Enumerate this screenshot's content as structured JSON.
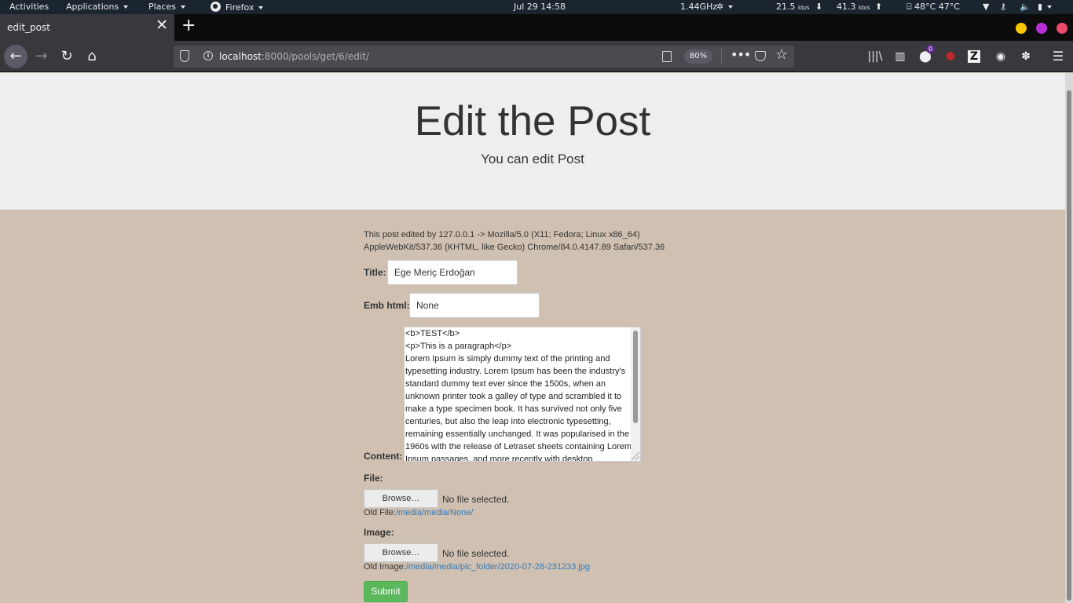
{
  "topbar": {
    "activities": "Activities",
    "applications": "Applications",
    "places": "Places",
    "firefox": "Firefox",
    "clock": "Jul 29  14:58",
    "cpu_freq": "1.44GHz",
    "net_down": "21.5",
    "net_down_unit": "kb/s",
    "net_up": "41.3",
    "net_up_unit": "kb/s",
    "temps": "48°C 47°C"
  },
  "browser": {
    "tab_title": "edit_post",
    "url_host": "localhost",
    "url_rest": ":8000/pools/get/6/edit/",
    "zoom": "80%",
    "notification_badge": "0",
    "window_button_colors": [
      "#f7c600",
      "#b52fd6",
      "#ec4a6b"
    ]
  },
  "page": {
    "heading": "Edit the Post",
    "subheading": "You can edit Post",
    "edit_info": "This post edited by 127.0.0.1 -> Mozilla/5.0 (X11; Fedora; Linux x86_64) AppleWebKit/537.36 (KHTML, like Gecko) Chrome/84.0.4147.89 Safari/537.36",
    "title_label": "Title:",
    "title_value": "Ege Meriç Erdoğan",
    "emb_label": "Emb html:",
    "emb_value": "None",
    "content_label": "Content:",
    "content_value": "<b>TEST</b>\n<p>This is a paragraph</p>\nLorem Ipsum is simply dummy text of the printing and typesetting industry. Lorem Ipsum has been the industry's standard dummy text ever since the 1500s, when an unknown printer took a galley of type and scrambled it to make a type specimen book. It has survived not only five centuries, but also the leap into electronic typesetting, remaining essentially unchanged. It was popularised in the 1960s with the release of Letraset sheets containing Lorem Ipsum passages, and more recently with desktop",
    "file_label": "File:",
    "browse_label": "Browse…",
    "no_file": "No file selected.",
    "old_file_label": "Old File:",
    "old_file_link": "/media/media/None/",
    "image_label": "Image:",
    "old_image_label": "Old Image:",
    "old_image_link": "/media/media/pic_folder/2020-07-28-231233.jpg",
    "submit_label": "Submit",
    "colors": {
      "jumbotron_bg": "#eeeeee",
      "page_bg": "#cfc0b1",
      "submit_bg": "#5cb85c",
      "link": "#337ab7"
    }
  }
}
